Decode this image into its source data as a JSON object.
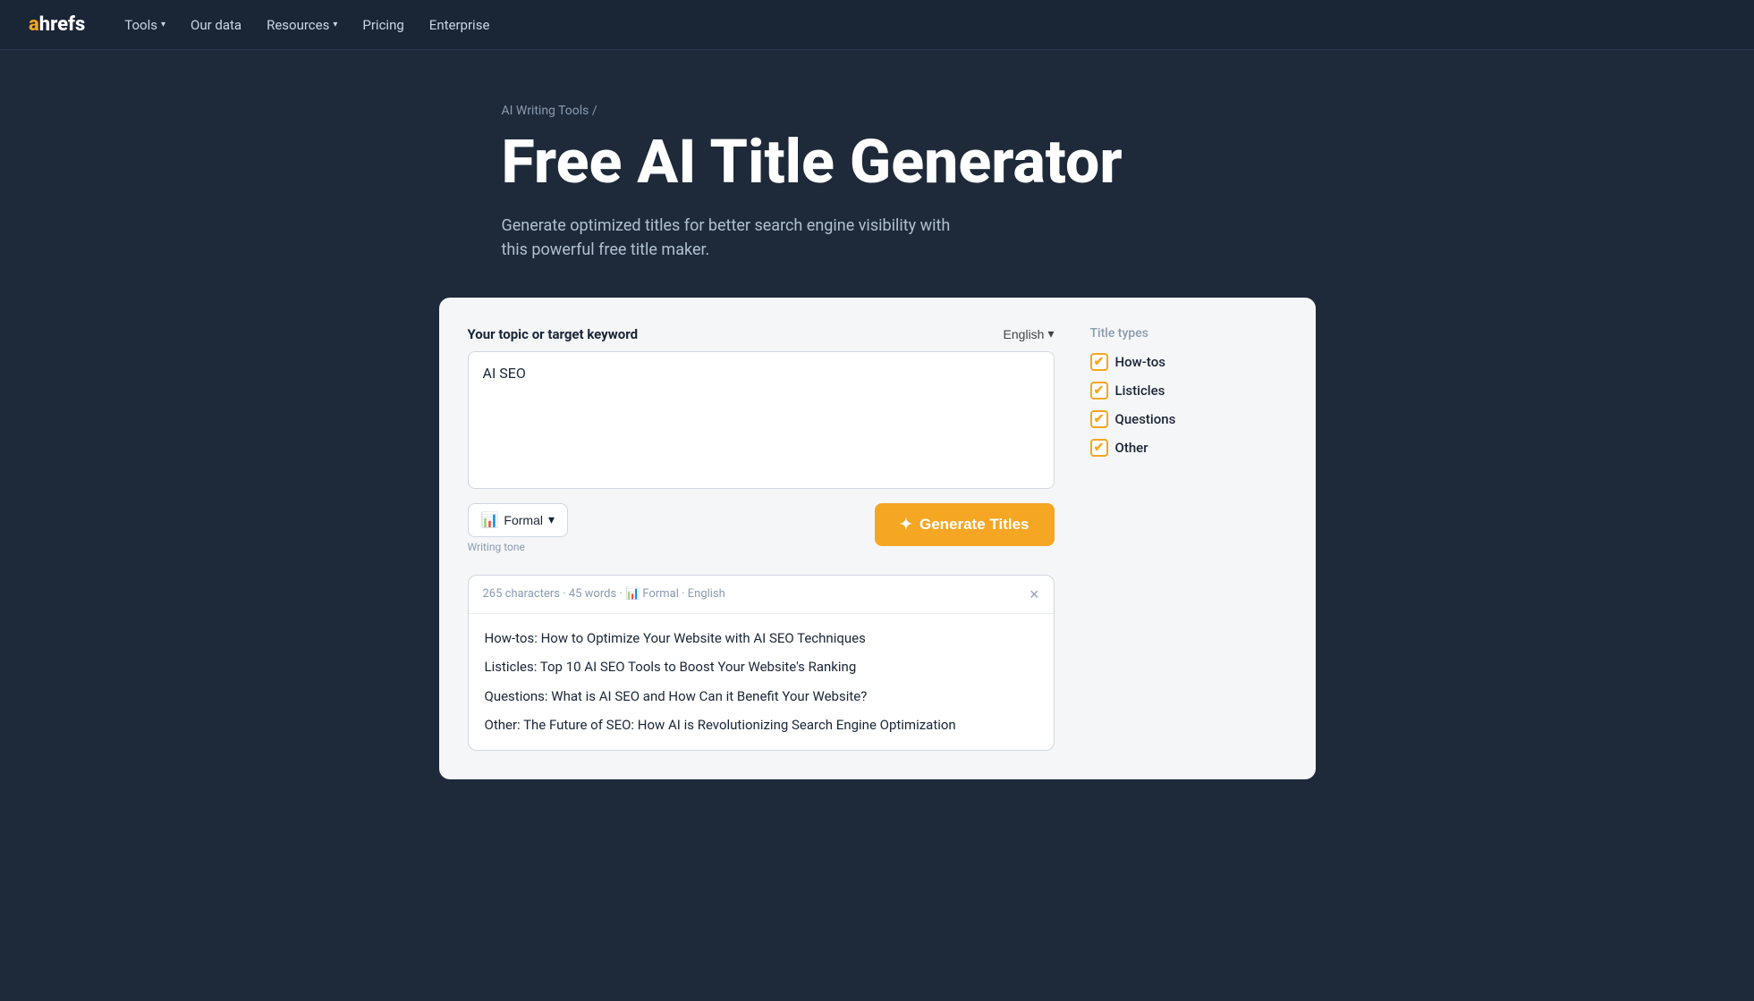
{
  "nav": {
    "logo_a": "a",
    "logo_hrefs": "hrefs",
    "items": [
      {
        "label": "Tools",
        "has_chevron": true
      },
      {
        "label": "Our data",
        "has_chevron": false
      },
      {
        "label": "Resources",
        "has_chevron": true
      },
      {
        "label": "Pricing",
        "has_chevron": false
      },
      {
        "label": "Enterprise",
        "has_chevron": false
      }
    ]
  },
  "hero": {
    "breadcrumb": "AI Writing Tools /",
    "title": "Free AI Title Generator",
    "subtitle": "Generate optimized titles for better search engine visibility with this powerful free title maker."
  },
  "tool": {
    "input_label": "Your topic or target keyword",
    "language": "English",
    "keyword_value_plain": "AI ",
    "keyword_value_underlined": "SEO",
    "tone_label": "Formal",
    "tone_icon": "📊",
    "writing_tone": "Writing tone",
    "generate_btn": "Generate Titles",
    "generate_icon": "✦"
  },
  "results": {
    "meta": "265 characters · 45 words · 📊 Formal · English",
    "close": "×",
    "items": [
      {
        "text": "How-tos: How to Optimize Your Website with AI SEO Techniques"
      },
      {
        "text": "Listicles: Top 10 AI SEO Tools to Boost Your Website's Ranking"
      },
      {
        "text": "Questions: What is AI SEO and How Can it Benefit Your Website?"
      },
      {
        "text": "Other: The Future of SEO: How AI is Revolutionizing Search Engine Optimization"
      }
    ]
  },
  "title_types": {
    "label": "Title types",
    "items": [
      {
        "label": "How-tos",
        "checked": true
      },
      {
        "label": "Listicles",
        "checked": true
      },
      {
        "label": "Questions",
        "checked": true
      },
      {
        "label": "Other",
        "checked": true
      }
    ]
  }
}
